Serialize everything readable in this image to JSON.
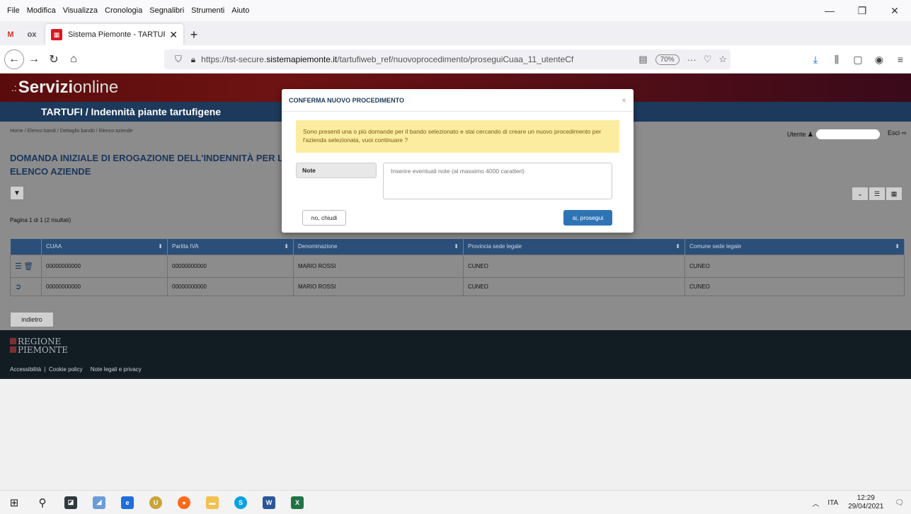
{
  "menu": [
    "File",
    "Modifica",
    "Visualizza",
    "Cronologia",
    "Segnalibri",
    "Strumenti",
    "Aiuto"
  ],
  "window_controls": {
    "minimize": "—",
    "restore": "❐",
    "close": "✕"
  },
  "tabs": {
    "pinned": [
      {
        "label": "M",
        "color": "#d93025"
      },
      {
        "label": "ox",
        "color": "#555555"
      }
    ],
    "active_title": "Sistema Piemonte - TARTUFI",
    "close": "✕",
    "new": "+"
  },
  "nav": {
    "url_prefix": "https://tst-secure.",
    "url_domain": "sistemapiemonte.it",
    "url_path": "/tartufiweb_ref/nuovoprocedimento/proseguiCuaa_11_utenteCf",
    "zoom": "70%"
  },
  "site": {
    "brand_bold": "Servizi",
    "brand_light": "online",
    "app_title": "TARTUFI / Indennità piante tartufigene",
    "breadcrumb": "Home  /  Elenco bandi  /  Dettaglio bando  /  Elenco aziende",
    "user_label": "Utente",
    "logout": "Esci",
    "page_title": "DOMANDA INIZIALE DI EROGAZIONE DELL'INDENNITÀ PER LA CO",
    "section_title": "ELENCO AZIENDE",
    "pagination": "Pagina 1 di 1 (2 risultati)",
    "back_button": "indietro"
  },
  "table": {
    "headers": [
      "CUAA",
      "Partita IVA",
      "Denominazione",
      "Provincia sede legale",
      "Comune sede legale"
    ],
    "rows": [
      {
        "cuaa": "00000000000",
        "piva": "00000000000",
        "denominazione": "MARIO ROSSI",
        "provincia": "CUNEO",
        "comune": "CUNEO"
      },
      {
        "cuaa": "00000000000",
        "piva": "00000000000",
        "denominazione": "MARIO ROSSI",
        "provincia": "CUNEO",
        "comune": "CUNEO"
      }
    ]
  },
  "footer": {
    "logo_line1": "REGIONE",
    "logo_line2": "PIEMONTE",
    "link_accessibility": "Accessibilità",
    "link_cookie": "Cookie policy",
    "link_legal": "Note legali e privacy"
  },
  "modal": {
    "title": "CONFERMA NUOVO PROCEDIMENTO",
    "close": "×",
    "warning": "Sono presenti una o più domande per il bando selezionato e stai cercando di creare un nuovo procedimento per l'azienda selezionata, vuoi continuare ?",
    "note_label": "Note",
    "note_placeholder": "Inserire eventuali note (al massimo 4000 caratteri)",
    "cancel_button": "no, chiudi",
    "confirm_button": "si, prosegui"
  },
  "taskbar": {
    "language": "ITA",
    "time": "12:29",
    "date": "29/04/2021"
  }
}
